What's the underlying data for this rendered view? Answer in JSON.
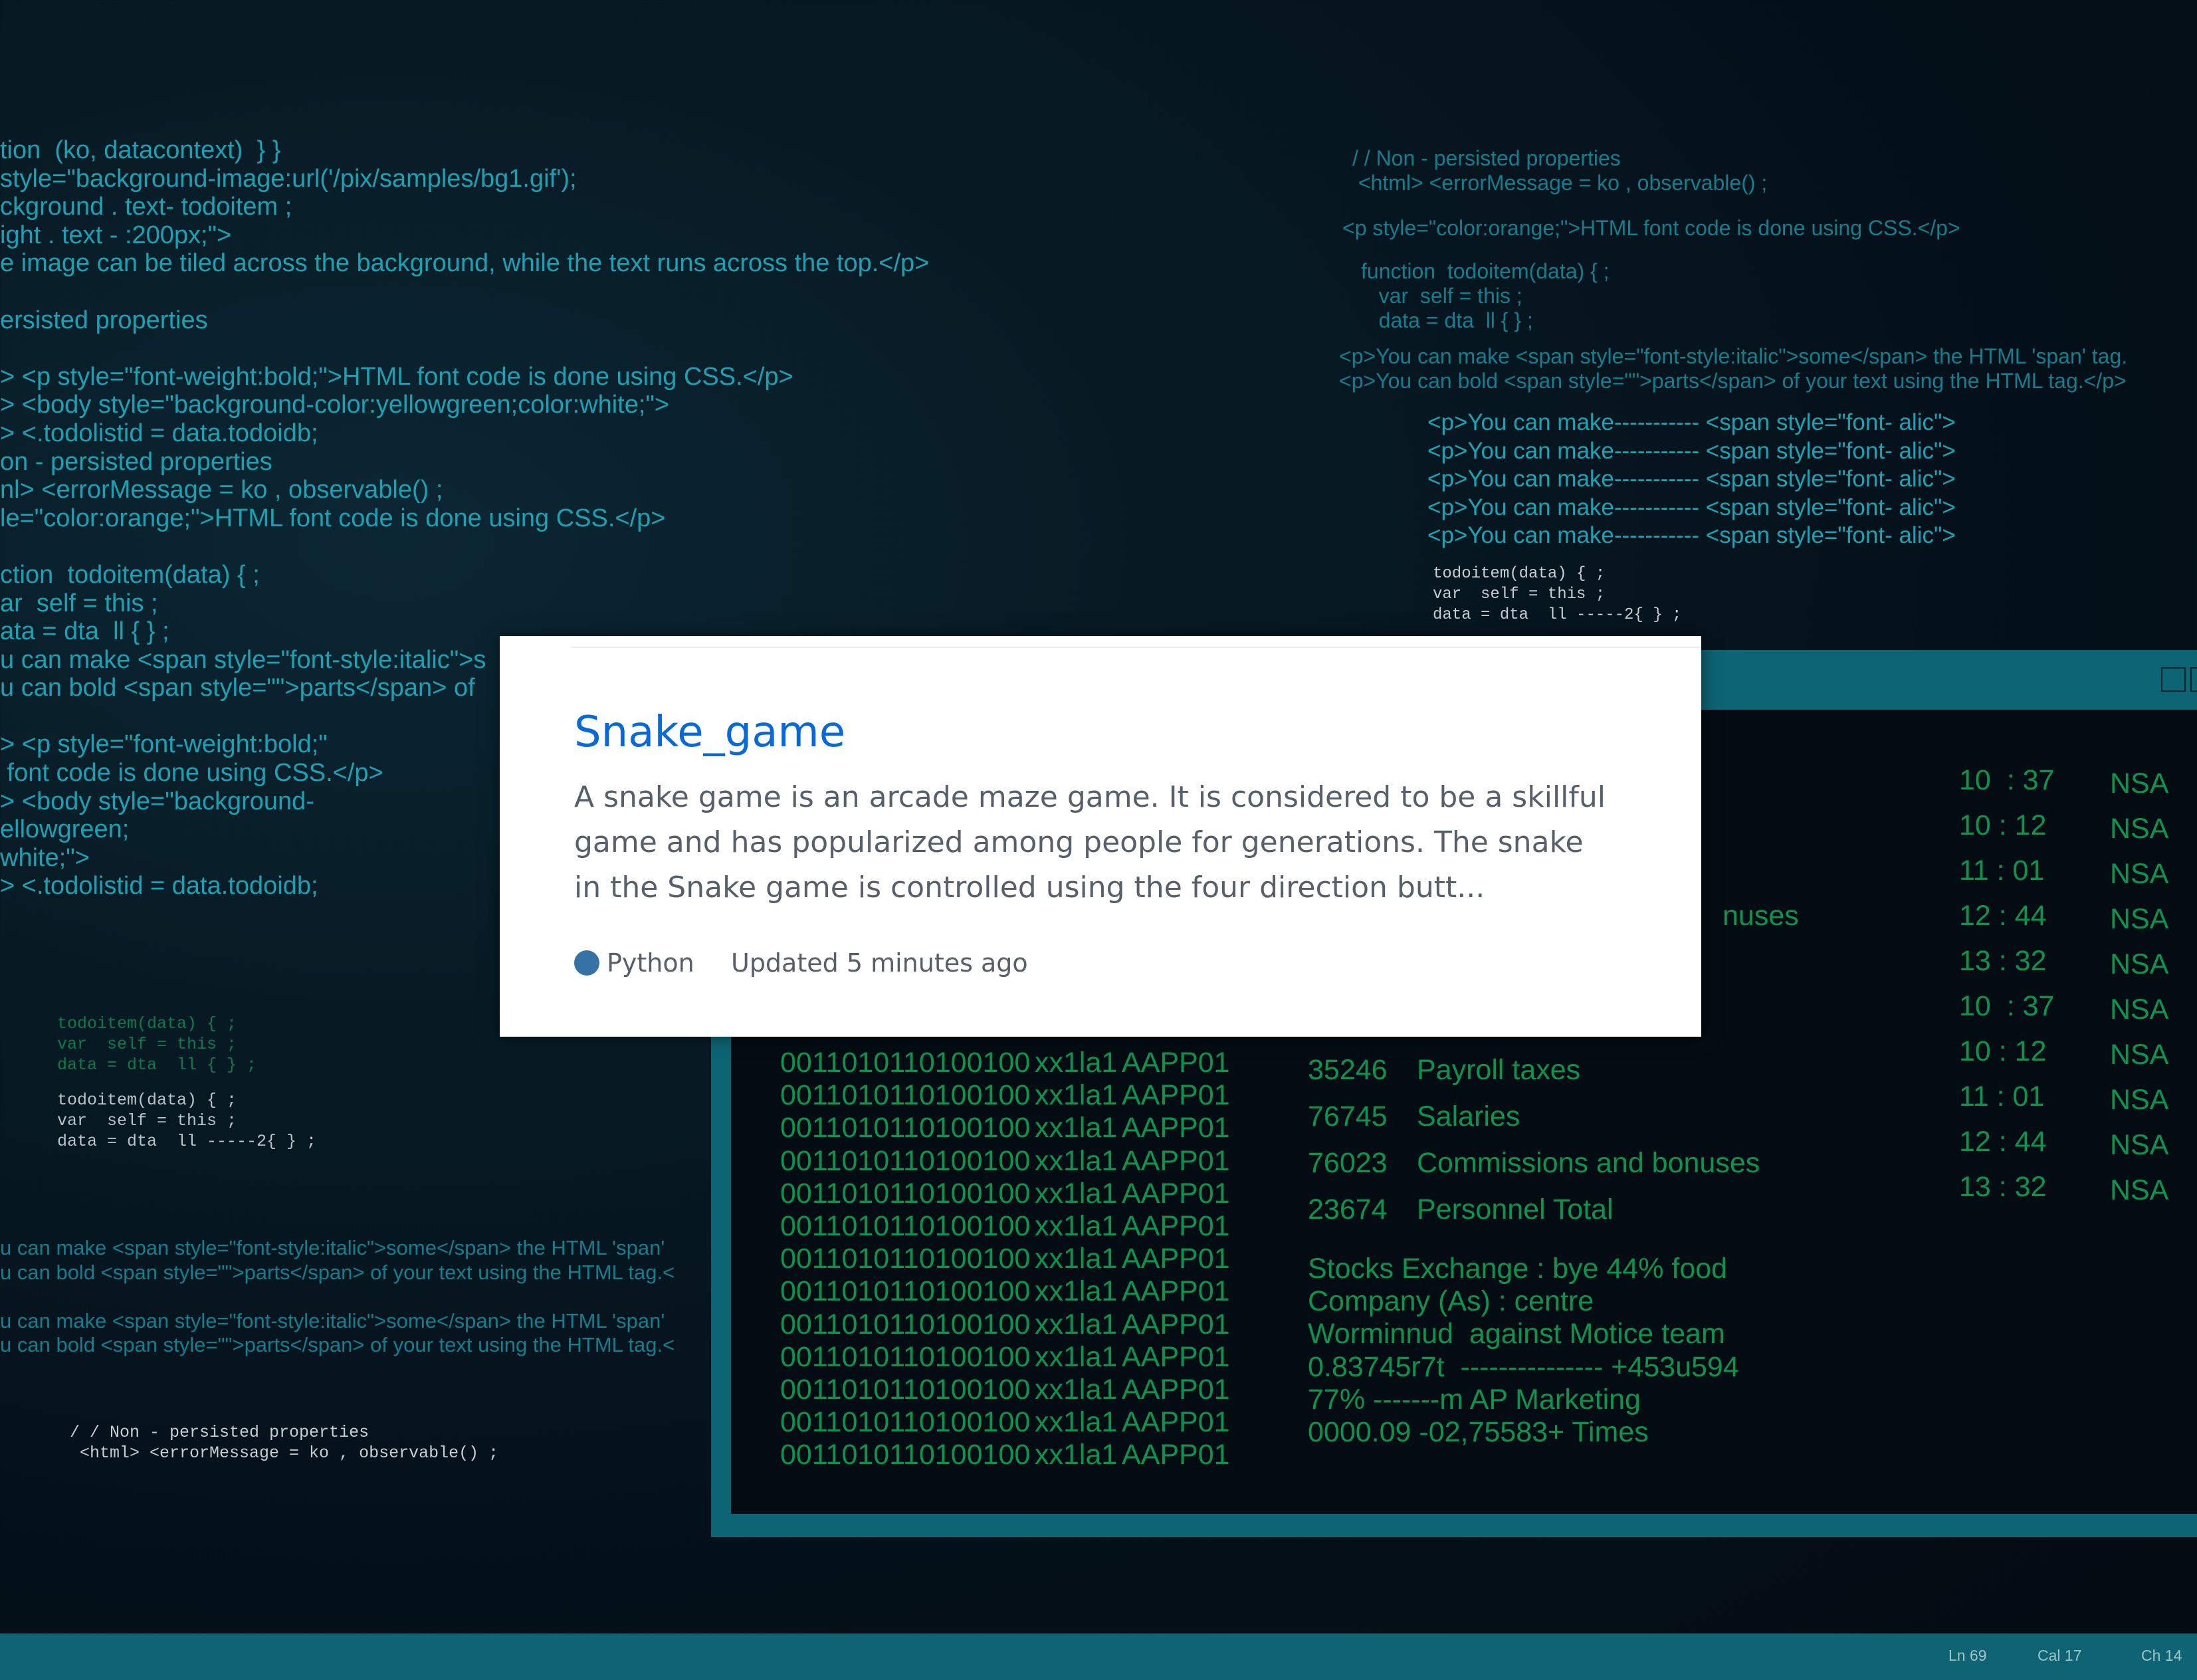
{
  "code_left": {
    "lines": [
      "tion  (ko, datacontext)  } }",
      "style=\"background-image:url('/pix/samples/bg1.gif');",
      "ckground . text- todoitem ;",
      "ight . text - :200px;\">",
      "e image can be tiled across the background, while the text runs across the top.</p>",
      "",
      "ersisted properties",
      "",
      "> <p style=\"font-weight:bold;\">HTML font code is done using CSS.</p>",
      "> <body style=\"background-color:yellowgreen;color:white;\">",
      "> <.todolistid = data.todoidb;",
      "on - persisted properties",
      "nl> <errorMessage = ko , observable() ;",
      "le=\"color:orange;\">HTML font code is done using CSS.</p>",
      "",
      "ction  todoitem(data) { ;",
      "ar  self = this ;",
      "ata = dta  ll { } ;",
      "u can make <span style=\"font-style:italic\">s",
      "u can bold <span style=\"\">parts</span> of",
      "",
      "> <p style=\"font-weight:bold;\"",
      " font code is done using CSS.</p>",
      "> <body style=\"background-",
      "ellowgreen;",
      "white;\">",
      "> <.todolistid = data.todoidb;"
    ],
    "small_green": [
      "todoitem(data) { ;",
      "var  self = this ;",
      "data = dta  ll { } ;"
    ],
    "small_grey": [
      "todoitem(data) { ;",
      "var  self = this ;",
      "data = dta  ll -----2{ } ;"
    ],
    "spans": [
      "u can make <span style=\"font-style:italic\">some</span> the HTML 'span'",
      "u can bold <span style=\"\">parts</span> of your text using the HTML tag.<",
      "",
      "u can make <span style=\"font-style:italic\">some</span> the HTML 'span'",
      "u can bold <span style=\"\">parts</span> of your text using the HTML tag.<"
    ],
    "bottom": [
      "/ / Non - persisted properties",
      " <html> <errorMessage = ko , observable() ;"
    ]
  },
  "code_right": {
    "top": [
      "/ / Non - persisted properties",
      " <html> <errorMessage = ko , observable() ;"
    ],
    "p_line": "<p style=\"color:orange;\">HTML font code is done using CSS.</p>",
    "fn": [
      "function  todoitem(data) { ;",
      "   var  self = this ;",
      "   data = dta  ll { } ;"
    ],
    "spans": [
      "<p>You can make <span style=\"font-style:italic\">some</span> the HTML 'span' tag.",
      "<p>You can bold <span style=\"\">parts</span> of your text using the HTML tag.</p>"
    ],
    "make_lines": [
      "<p>You can make----------- <span style=\"font- alic\">",
      "<p>You can make----------- <span style=\"font- alic\">",
      "<p>You can make----------- <span style=\"font- alic\">",
      "<p>You can make----------- <span style=\"font- alic\">",
      "<p>You can make----------- <span style=\"font- alic\">"
    ],
    "mono": [
      "todoitem(data) { ;",
      "var  self = this ;",
      "data = dta  ll -----2{ } ;"
    ]
  },
  "terminal": {
    "binary": "0011010110100100",
    "binary_rows": 13,
    "xx": "xx1la1",
    "app": "AAPP01",
    "times": [
      "10  : 37",
      "10 : 12",
      "11 : 01",
      "12 : 44",
      "13 : 32",
      "10  : 37",
      "10 : 12",
      "11 : 01",
      "12 : 44",
      "13 : 32"
    ],
    "nsa": [
      "NSA",
      "NSA",
      "NSA",
      "NSA",
      "NSA",
      "NSA",
      "NSA",
      "NSA",
      "NSA",
      "NSA"
    ],
    "accounts": [
      {
        "num": "35246",
        "name": "Payroll taxes"
      },
      {
        "num": "76745",
        "name": "Salaries"
      },
      {
        "num": "76023",
        "name": "Commissions and bonuses"
      },
      {
        "num": "23674",
        "name": "Personnel Total"
      }
    ],
    "bonus_peek": "nuses",
    "stocks": [
      "Stocks Exchange : bye 44% food",
      "Company (As) : centre",
      "Worminnud  against Motice team",
      "0.83745r7t  --------------- +453u594",
      "77% -------m AP Marketing",
      "0000.09 -02,75583+ Times"
    ]
  },
  "statusbar": {
    "ln": "Ln 69",
    "col": "Cal 17",
    "ch": "Ch 14"
  },
  "card": {
    "title": "Snake_game",
    "description": "A snake game is an arcade maze game. It is considered to be a skillful game and has popularized among people for generations. The snake in the Snake game is controlled using the four direction butt...",
    "language": "Python",
    "language_color": "#3572a5",
    "updated": "Updated 5 minutes ago"
  }
}
